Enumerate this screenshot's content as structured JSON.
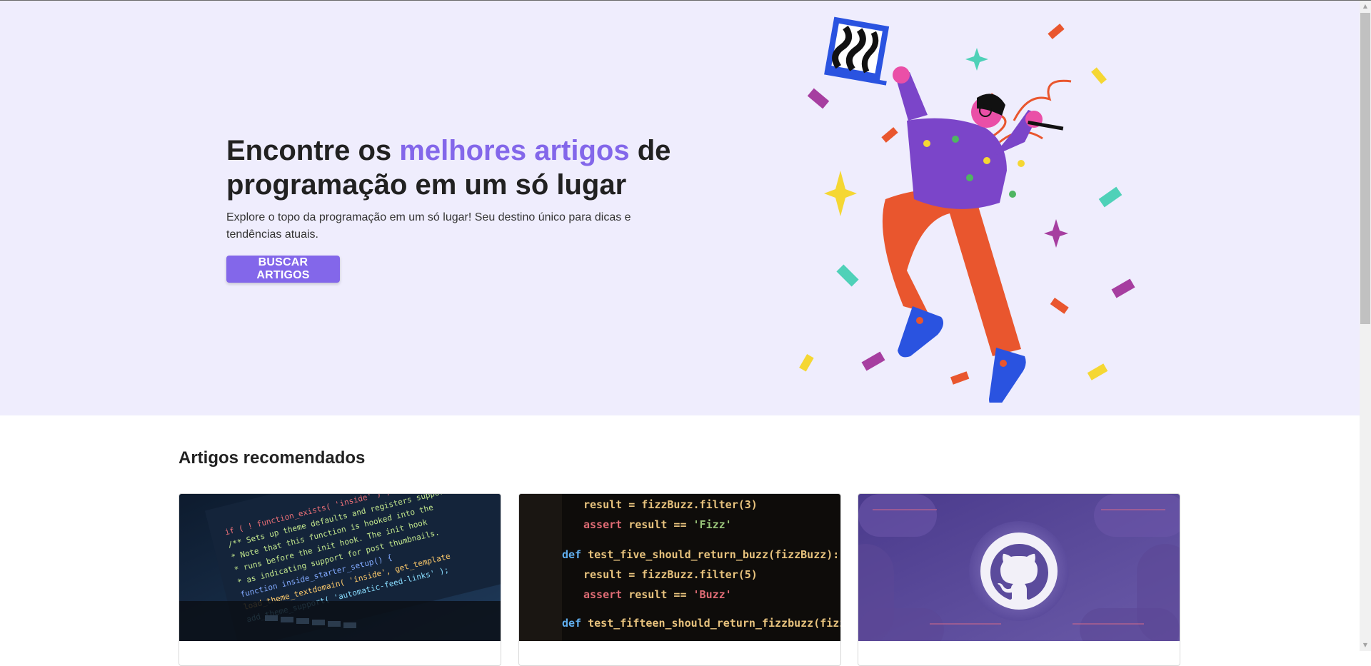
{
  "hero": {
    "title_part1": "Encontre os ",
    "title_accent": "melhores artigos",
    "title_part2": " de programação em um só lugar",
    "subtitle": "Explore o topo da programação em um só lugar! Seu destino único para dicas e tendências atuais.",
    "button_label": "BUSCAR ARTIGOS",
    "accent_color": "#8367ea",
    "background_color": "#efedfd"
  },
  "recommended": {
    "title": "Artigos recomendados",
    "cards": [
      {
        "image": "code-laptop-photo"
      },
      {
        "image": "fizzbuzz-code-photo"
      },
      {
        "image": "github-logo-banner"
      }
    ]
  },
  "scrollbar": {
    "up_arrow": "▲",
    "down_arrow": "▼"
  }
}
